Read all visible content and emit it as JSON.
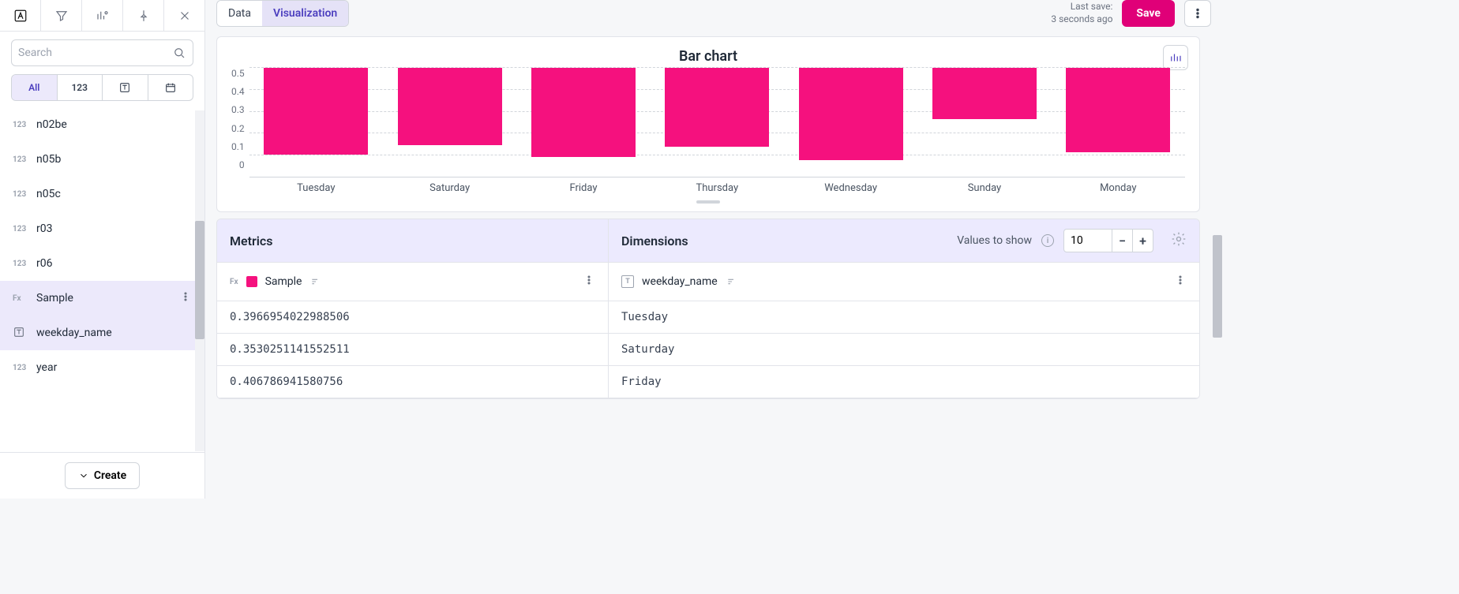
{
  "sidebar": {
    "search_placeholder": "Search",
    "filters": {
      "all": "All",
      "num": "123"
    },
    "fields": [
      {
        "type": "123",
        "name": "n02be",
        "selected": false
      },
      {
        "type": "123",
        "name": "n05b",
        "selected": false
      },
      {
        "type": "123",
        "name": "n05c",
        "selected": false
      },
      {
        "type": "123",
        "name": "r03",
        "selected": false
      },
      {
        "type": "123",
        "name": "r06",
        "selected": false
      },
      {
        "type": "Fx",
        "name": "Sample",
        "selected": true,
        "show_menu": true
      },
      {
        "type": "T",
        "name": "weekday_name",
        "selected": true
      },
      {
        "type": "123",
        "name": "year",
        "selected": false
      }
    ],
    "create": "Create"
  },
  "topbar": {
    "tabs": {
      "data": "Data",
      "viz": "Visualization"
    },
    "last_save_label": "Last save:",
    "last_save_value": "3 seconds ago",
    "save": "Save"
  },
  "chart": {
    "title": "Bar chart"
  },
  "chart_data": {
    "type": "bar",
    "title": "Bar chart",
    "categories": [
      "Tuesday",
      "Saturday",
      "Friday",
      "Thursday",
      "Wednesday",
      "Sunday",
      "Monday"
    ],
    "values": [
      0.397,
      0.353,
      0.407,
      0.36,
      0.42,
      0.235,
      0.385
    ],
    "series": [
      {
        "name": "Sample",
        "color": "#f5117e",
        "values": [
          0.397,
          0.353,
          0.407,
          0.36,
          0.42,
          0.235,
          0.385
        ]
      }
    ],
    "xlabel": "",
    "ylabel": "",
    "ylim": [
      0,
      0.5
    ],
    "yticks": [
      0,
      0.1,
      0.2,
      0.3,
      0.4,
      0.5
    ]
  },
  "config": {
    "metrics_header": "Metrics",
    "dimensions_header": "Dimensions",
    "values_to_show_label": "Values to show",
    "values_to_show": "10",
    "metric_items": [
      {
        "badge": "Fx",
        "name": "Sample",
        "swatch": "#f5117e"
      }
    ],
    "dimension_items": [
      {
        "badge": "T",
        "name": "weekday_name"
      }
    ],
    "rows": [
      {
        "metric": "0.3966954022988506",
        "dim": "Tuesday"
      },
      {
        "metric": "0.3530251141552511",
        "dim": "Saturday"
      },
      {
        "metric": "0.406786941580756",
        "dim": "Friday"
      }
    ]
  }
}
